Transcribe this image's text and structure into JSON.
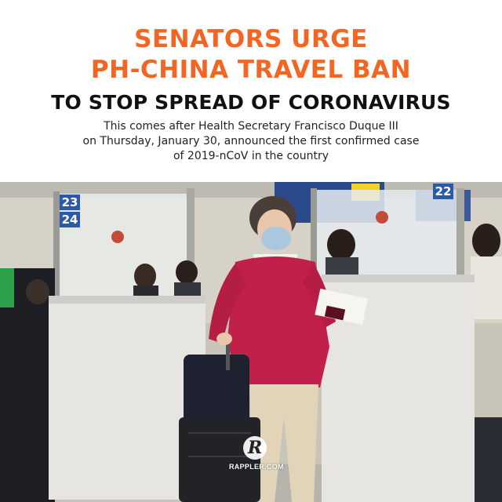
{
  "headline": {
    "line1": "SENATORS URGE",
    "line2": "PH-CHINA TRAVEL BAN",
    "line3": "TO STOP SPREAD OF CORONAVIRUS"
  },
  "subtext": {
    "line1": "This comes after Health Secretary Francisco Duque III",
    "line2": "on Thursday, January 30, announced the first confirmed case",
    "line3": "of 2019-nCoV in the country"
  },
  "photo": {
    "counter_numbers": [
      "23",
      "24",
      "22"
    ]
  },
  "logo": {
    "mark": "R",
    "text": "RAPPLER.COM"
  },
  "colors": {
    "headline_accent": "#f26522",
    "headline_dark": "#111111",
    "sign_blue": "#2d5aa8",
    "cardigan": "#c0204a"
  }
}
